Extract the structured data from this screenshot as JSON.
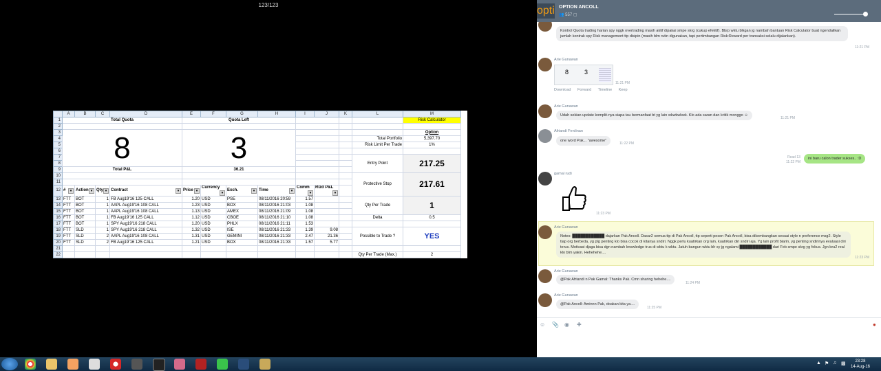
{
  "viewer": {
    "counter": "123/123"
  },
  "sheet": {
    "columns": [
      "A",
      "B",
      "C",
      "D",
      "E",
      "F",
      "G",
      "H",
      "I",
      "J",
      "K",
      "L",
      "M"
    ],
    "total_quota_label": "Total Quota",
    "total_quota_value": "8",
    "quota_left_label": "Quota Left",
    "quota_left_value": "3",
    "total_pl_label": "Total P&L",
    "total_pl_value": "36.21",
    "risk_calc_label": "Risk Calculator",
    "option_label": "Option",
    "total_portfolio_label": "Total Portfolio",
    "total_portfolio_value": "5,397.70",
    "risk_limit_label": "Risk Limit Per Trade",
    "risk_limit_value": "1%",
    "entry_point_label": "Entry Point",
    "entry_point_value": "217.25",
    "protective_stop_label": "Protective Stop",
    "protective_stop_value": "217.61",
    "qty_per_trade_label": "Qty Per Trade",
    "qty_per_trade_value": "1",
    "delta_label": "Delta",
    "delta_value": "0.5",
    "possible_label": "Possible to Trade ?",
    "possible_value": "YES",
    "qty_max_label": "Qty Per Trade (Max.)",
    "qty_max_value": "2",
    "trade_headers": [
      "#",
      "Action",
      "Qty",
      "Contract",
      "Price",
      "Currency",
      "Exch.",
      "Time",
      "Comm",
      "Rlzd P&L"
    ],
    "trades": [
      [
        "FTT",
        "BOT",
        "1",
        "FB Aug19'16 125 CALL",
        "1.20",
        "USD",
        "PSE",
        "08/11/2016 20:59",
        "1.57",
        ""
      ],
      [
        "FTT",
        "BOT",
        "1",
        "AAPL Aug19'16 108 CALL",
        "1.23",
        "USD",
        "BOX",
        "08/11/2016 21:03",
        "1.08",
        ""
      ],
      [
        "FTT",
        "BOT",
        "1",
        "AAPL Aug19'16 108 CALL",
        "1.13",
        "USD",
        "AMEX",
        "08/11/2016 21:09",
        "1.08",
        ""
      ],
      [
        "FTT",
        "BOT",
        "1",
        "FB Aug19'16 125 CALL",
        "1.12",
        "USD",
        "CBOE",
        "08/11/2016 21:10",
        "1.08",
        ""
      ],
      [
        "FTT",
        "BOT",
        "1",
        "SPY Aug19'16 218 CALL",
        "1.20",
        "USD",
        "PHLX",
        "08/11/2016 21:11",
        "1.53",
        ""
      ],
      [
        "FTT",
        "SLD",
        "1",
        "SPY Aug19'16 218 CALL",
        "1.32",
        "USD",
        "ISE",
        "08/11/2016 21:33",
        "1.39",
        "9.08"
      ],
      [
        "FTT",
        "SLD",
        "2",
        "AAPL Aug19'16 108 CALL",
        "1.31",
        "USD",
        "GEMINI",
        "08/11/2016 21:33",
        "2.47",
        "21.36"
      ],
      [
        "FTT",
        "SLD",
        "2",
        "FB Aug19'16 125 CALL",
        "1.21",
        "USD",
        "BOX",
        "08/11/2016 21:33",
        "1.57",
        "5.77"
      ]
    ]
  },
  "chat": {
    "title": "OPTION ANCOLL",
    "member_count": "557",
    "logo_text": "optic",
    "messages": [
      {
        "text": "Kontrol Quota trading harian spy nggk overtrading masih aktif dipakai smpe skrg (cukup efektif). Bbrp wktu blkgan jg nambah bantuan Risk Calculator buat ngendalikan jumlah kontrak spy Risk management ttp disipin (masih blm rutin digunakan, tapi pertimbangan Risk:Reward per transaksi selalu dijalankan).",
        "time": "11:21 PM"
      },
      {
        "author": "Arie Gunawan",
        "time": "11:21 PM",
        "actions": [
          "Download",
          "Forward",
          "Timeline",
          "Keep"
        ],
        "thumb_values": [
          "8",
          "3"
        ]
      },
      {
        "author": "Arie Gunawan",
        "text": "Udah sekian update komplit-nya siapa tau bermanfaat bt yg lain wkwkwkwk. Klo ada saran dan kritik monggo",
        "time": "11:21 PM"
      },
      {
        "author": "Afriandi Ferdinan",
        "text": "one word Pak... \"awesome\"",
        "time": "11:22 PM"
      },
      {
        "text": "ini baru calon trader sukses.. :D",
        "read": "Read 13",
        "time": "11:22 PM"
      },
      {
        "author": "gamal rudi",
        "time": "11:23 PM"
      },
      {
        "author": "Arie Gunawan",
        "text": "Notes: ████████████ dajarkan Pak Ancoll. Dasar2 semua ttp di Pak Ancoll, ttp seperti pesen Pak Ancoll, bisa dikembangkan sesuai style n preference msg2. Style tiap org berbeda, yg plg penting klo bisa cocok di kitanya sndiri. Nggk perlu kuatirkan org lain, kuatirkan diri sndiri aja. Yg lain profit biarin, yg penting sndirinya evaluasi diri terus. Motivasi djaga bisa dgn nambah knowledge trus di wktu k wktu. Jatuh bangun wktu blr sy jg ngalami ████████████ dari Feb smpe skrg yg fokus. Jgn bru2 real klo blm yakin. Hehehehe....",
        "time": "11:23 PM"
      },
      {
        "author": "Arie Gunawan",
        "text": "@Pak Afriandi n Pak Gamal: Thanks Pak. Cmn sharing hehehe....",
        "time": "11:24 PM"
      },
      {
        "author": "Arie Gunawan",
        "text": "@Pak Ancoll: Aminnn Pak, doakan kita ya....",
        "time": "11:25 PM"
      }
    ]
  },
  "taskbar": {
    "time": "23:28",
    "date": "14-Aug-16"
  }
}
